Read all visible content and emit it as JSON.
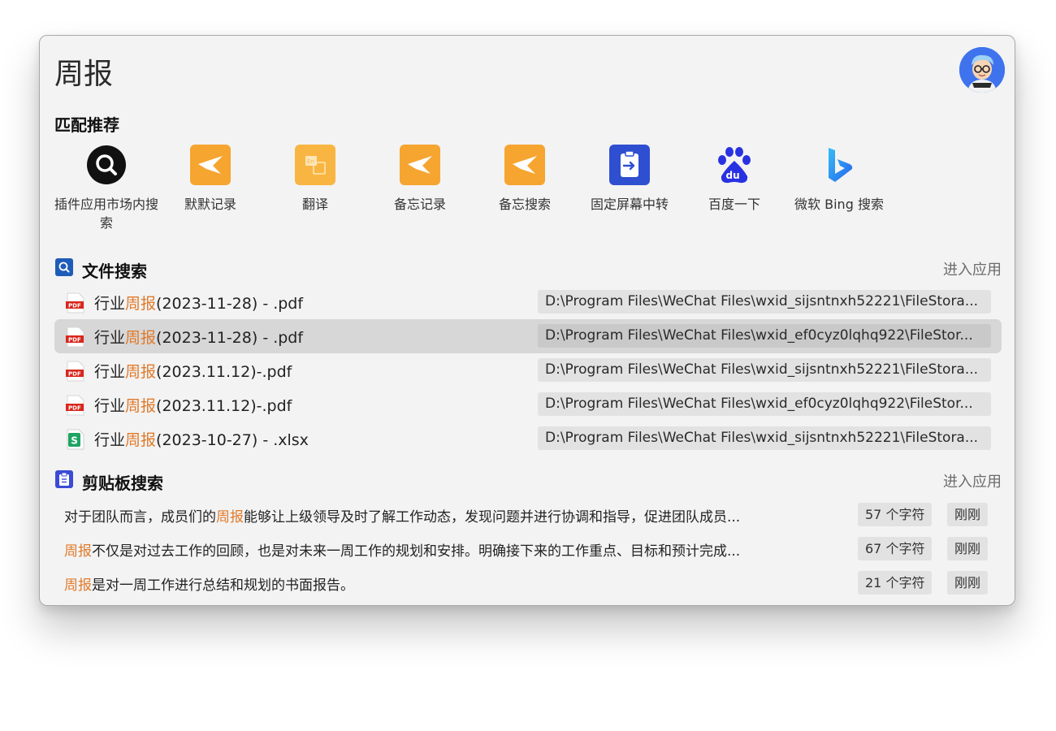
{
  "search": {
    "query": "周报"
  },
  "matched": {
    "title": "匹配推荐",
    "apps": [
      {
        "label": "插件应用市场内搜索",
        "icon": "search-circle-icon"
      },
      {
        "label": "默默记录",
        "icon": "star-note-icon"
      },
      {
        "label": "翻译",
        "icon": "translate-icon"
      },
      {
        "label": "备忘记录",
        "icon": "star-note-icon"
      },
      {
        "label": "备忘搜索",
        "icon": "star-note-icon"
      },
      {
        "label": "固定屏幕中转",
        "icon": "clipboard-transfer-icon"
      },
      {
        "label": "百度一下",
        "icon": "baidu-paw-icon"
      },
      {
        "label": "微软 Bing 搜索",
        "icon": "bing-icon"
      }
    ]
  },
  "file_search": {
    "title": "文件搜索",
    "enter_label": "进入应用",
    "rows": [
      {
        "prefix": "行业",
        "hl": "周报",
        "suffix": "(2023-11-28) - .pdf",
        "path": "D:\\Program Files\\WeChat Files\\wxid_sijsntnxh52221\\FileStora...",
        "icon": "pdf-icon"
      },
      {
        "prefix": "行业",
        "hl": "周报",
        "suffix": "(2023-11-28) - .pdf",
        "path": "D:\\Program Files\\WeChat Files\\wxid_ef0cyz0lqhq922\\FileStor...",
        "icon": "pdf-icon"
      },
      {
        "prefix": "行业",
        "hl": "周报",
        "suffix": "(2023.11.12)-.pdf",
        "path": "D:\\Program Files\\WeChat Files\\wxid_sijsntnxh52221\\FileStora...",
        "icon": "pdf-icon"
      },
      {
        "prefix": "行业",
        "hl": "周报",
        "suffix": "(2023.11.12)-.pdf",
        "path": "D:\\Program Files\\WeChat Files\\wxid_ef0cyz0lqhq922\\FileStor...",
        "icon": "pdf-icon"
      },
      {
        "prefix": "行业",
        "hl": "周报",
        "suffix": "(2023-10-27) - .xlsx",
        "path": "D:\\Program Files\\WeChat Files\\wxid_sijsntnxh52221\\FileStora...",
        "icon": "spreadsheet-icon"
      }
    ]
  },
  "clipboard": {
    "title": "剪贴板搜索",
    "enter_label": "进入应用",
    "rows": [
      {
        "prefix": "对于团队而言，成员们的",
        "hl": "周报",
        "suffix": "能够让上级领导及时了解工作动态，发现问题并进行协调和指导，促进团队成员...",
        "count": "57 个字符",
        "time": "刚刚"
      },
      {
        "prefix": "",
        "hl": "周报",
        "suffix": "不仅是对过去工作的回顾，也是对未来一周工作的规划和安排。明确接下来的工作重点、目标和预计完成...",
        "count": "67 个字符",
        "time": "刚刚"
      },
      {
        "prefix": "",
        "hl": "周报",
        "suffix": "是对一周工作进行总结和规划的书面报告。",
        "count": "21 个字符",
        "time": "刚刚"
      }
    ]
  },
  "colors": {
    "highlight": "#e07a2a",
    "selected_row": "#d7d7d7",
    "chip": "#e2e2e2"
  }
}
